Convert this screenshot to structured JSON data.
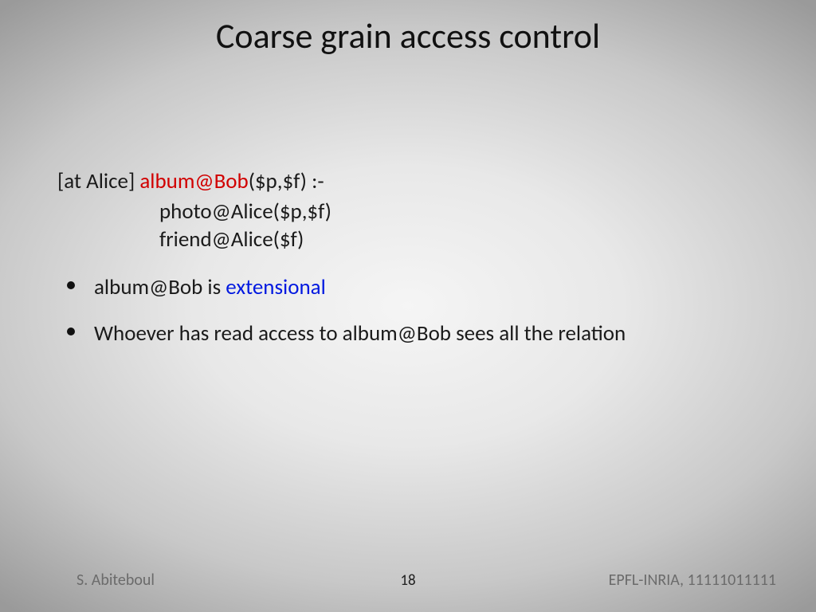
{
  "title": "Coarse grain access control",
  "rule": {
    "prefix": "[at Alice] ",
    "head_predicate": "album@Bob",
    "head_args": "($p,$f) :-",
    "body1": "photo@Alice($p,$f)",
    "body2": "friend@Alice($f)"
  },
  "bullets": [
    {
      "pre": "album@Bob is ",
      "highlight": "extensional",
      "post": ""
    },
    {
      "pre": "Whoever has read access to album@Bob sees all the relation",
      "highlight": "",
      "post": ""
    }
  ],
  "footer": {
    "left": "S. Abiteboul",
    "center": "18",
    "right": "EPFL-INRIA,  11111011111"
  },
  "colors": {
    "red": "#d10000",
    "blue": "#0018e0"
  }
}
